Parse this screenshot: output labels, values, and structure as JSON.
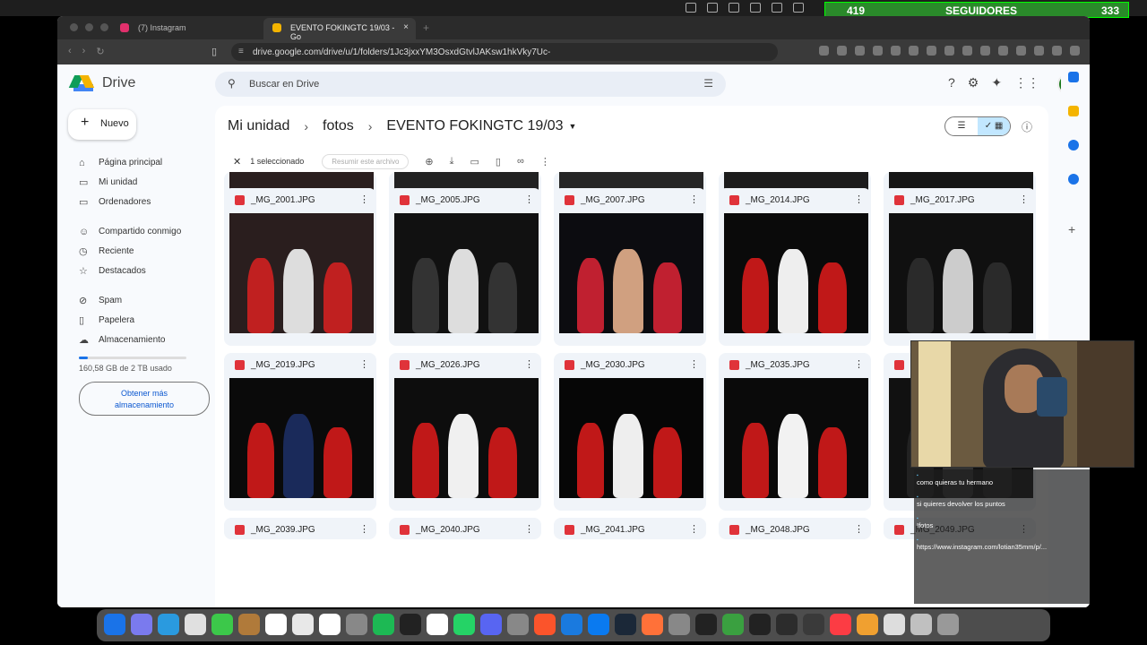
{
  "followers": {
    "left": "419",
    "label": "SEGUIDORES",
    "right": "333"
  },
  "browser": {
    "tabs": [
      {
        "title": "(7) Instagram"
      },
      {
        "title": "EVENTO FOKINGTC 19/03 - Go",
        "close": "×"
      }
    ],
    "new_tab": "+",
    "url": "drive.google.com/drive/u/1/folders/1Jc3jxxYM3OsxdGtvlJAKsw1hkVky7Uc-"
  },
  "drive": {
    "logo_text": "Drive",
    "search_placeholder": "Buscar en Drive",
    "avatar_letter": "c",
    "new_button": "Nuevo",
    "sidebar": [
      {
        "label": "Página principal",
        "icon": "home-icon",
        "glyph": "⌂"
      },
      {
        "label": "Mi unidad",
        "icon": "drive-icon",
        "glyph": "▭"
      },
      {
        "label": "Ordenadores",
        "icon": "computer-icon",
        "glyph": "▭"
      },
      {
        "label": "Compartido conmigo",
        "icon": "shared-icon",
        "glyph": "☺"
      },
      {
        "label": "Reciente",
        "icon": "clock-icon",
        "glyph": "◷"
      },
      {
        "label": "Destacados",
        "icon": "star-icon",
        "glyph": "☆"
      },
      {
        "label": "Spam",
        "icon": "spam-icon",
        "glyph": "⊘"
      },
      {
        "label": "Papelera",
        "icon": "trash-icon",
        "glyph": "▯"
      },
      {
        "label": "Almacenamiento",
        "icon": "cloud-icon",
        "glyph": "☁"
      }
    ],
    "storage_used_fraction": 0.08,
    "storage_text": "160,58 GB de 2 TB usado",
    "get_more_line1": "Obtener más",
    "get_more_line2": "almacenamiento",
    "breadcrumb": [
      "Mi unidad",
      "fotos",
      "EVENTO FOKINGTC 19/03"
    ],
    "selection": {
      "count_text": "1 seleccionado",
      "summarize": "Resumir este archivo"
    },
    "files": [
      {
        "name": "_MG_2001.JPG"
      },
      {
        "name": "_MG_2005.JPG"
      },
      {
        "name": "_MG_2007.JPG"
      },
      {
        "name": "_MG_2014.JPG"
      },
      {
        "name": "_MG_2017.JPG"
      },
      {
        "name": "_MG_2019.JPG"
      },
      {
        "name": "_MG_2026.JPG"
      },
      {
        "name": "_MG_2030.JPG"
      },
      {
        "name": "_MG_2035.JPG"
      },
      {
        "name": ""
      },
      {
        "name": "_MG_2039.JPG"
      },
      {
        "name": "_MG_2040.JPG"
      },
      {
        "name": "_MG_2041.JPG"
      },
      {
        "name": "_MG_2048.JPG"
      },
      {
        "name": "_MG_2049.JPG"
      }
    ]
  },
  "chat": [
    {
      "text": "como quieras tu hermano"
    },
    {
      "text": "si quieres devolver los puntos"
    },
    {
      "text": "!fotos"
    },
    {
      "text": "https://www.instagram.com/lotian35mm/p/..."
    }
  ]
}
